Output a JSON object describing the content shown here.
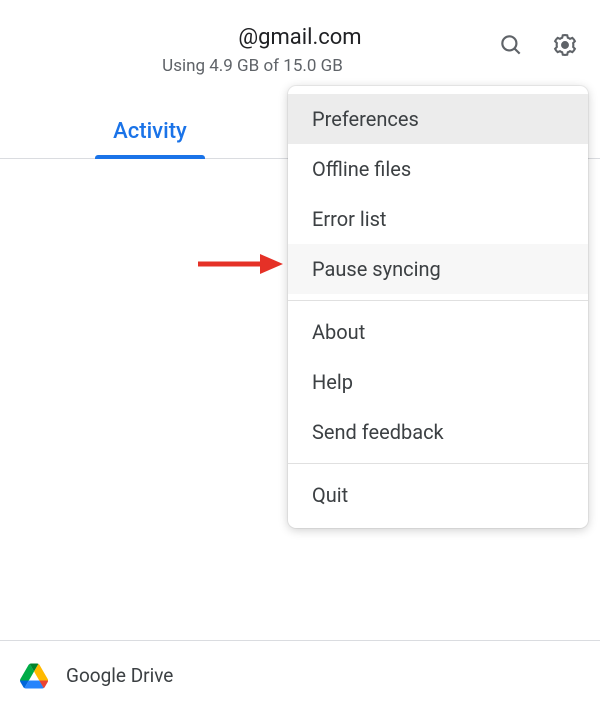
{
  "header": {
    "email": "@gmail.com",
    "storage": "Using 4.9 GB of 15.0 GB"
  },
  "tabs": {
    "activity": "Activity"
  },
  "menu": {
    "preferences": "Preferences",
    "offline_files": "Offline files",
    "error_list": "Error list",
    "pause_syncing": "Pause syncing",
    "about": "About",
    "help": "Help",
    "send_feedback": "Send feedback",
    "quit": "Quit"
  },
  "footer": {
    "app_name": "Google Drive"
  }
}
